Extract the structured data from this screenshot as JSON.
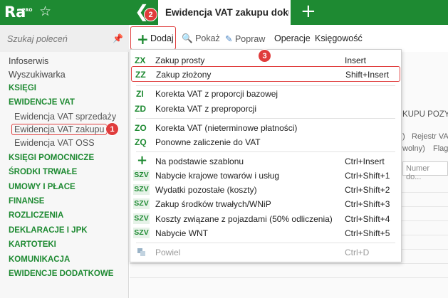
{
  "app": {
    "logo_text": "Ra",
    "logo_badge": "PRO",
    "active_tab": "Ewidencja VAT zakupu dokumenty"
  },
  "sidebar": {
    "search_placeholder": "Szukaj poleceń",
    "items": [
      {
        "label": "Infoserwis"
      },
      {
        "label": "Wyszukiwarka"
      },
      {
        "label": "KSIĘGI"
      },
      {
        "label": "EWIDENCJE VAT"
      },
      {
        "label": "Ewidencja VAT sprzedaży"
      },
      {
        "label": "Ewidencja VAT zakupu"
      },
      {
        "label": "Ewidencja VAT OSS"
      },
      {
        "label": "KSIĘGI POMOCNICZE"
      },
      {
        "label": "ŚRODKI TRWAŁE"
      },
      {
        "label": "UMOWY I PŁACE"
      },
      {
        "label": "FINANSE"
      },
      {
        "label": "ROZLICZENIA"
      },
      {
        "label": "DEKLARACJE I JPK"
      },
      {
        "label": "KARTOTEKI"
      },
      {
        "label": "KOMUNIKACJA"
      },
      {
        "label": "EWIDENCJE DODATKOWE"
      }
    ]
  },
  "toolbar": {
    "add_label": "Dodaj",
    "show_label": "Pokaż",
    "edit_label": "Popraw",
    "operations_label": "Operacje",
    "accounting_label": "Księgowość"
  },
  "background": {
    "title_fragment": "KUPU POZY",
    "rejestr": "Rejestr VA",
    "dowolny": "wolny)",
    "flag": "Flag",
    "paren": ")",
    "number_placeholder": "Numer do..."
  },
  "badges": {
    "one": "1",
    "two": "2",
    "three": "3"
  },
  "menu": {
    "items": [
      {
        "code": "ZX",
        "label": "Zakup prosty",
        "shortcut": "Insert"
      },
      {
        "code": "ZZ",
        "label": "Zakup złożony",
        "shortcut": "Shift+Insert"
      },
      {
        "code": "ZI",
        "label": "Korekta VAT z proporcji bazowej",
        "shortcut": ""
      },
      {
        "code": "ZD",
        "label": "Korekta VAT z preproporcji",
        "shortcut": ""
      },
      {
        "code": "ZO",
        "label": "Korekta VAT (nieterminowe płatności)",
        "shortcut": ""
      },
      {
        "code": "ZQ",
        "label": "Ponowne zaliczenie do VAT",
        "shortcut": ""
      },
      {
        "code": "",
        "label": "Na podstawie szablonu",
        "shortcut": "Ctrl+Insert"
      },
      {
        "code": "SZV",
        "label": "Nabycie krajowe towarów i usług",
        "shortcut": "Ctrl+Shift+1"
      },
      {
        "code": "SZV",
        "label": "Wydatki pozostałe (koszty)",
        "shortcut": "Ctrl+Shift+2"
      },
      {
        "code": "SZV",
        "label": "Zakup środków trwałych/WNiP",
        "shortcut": "Ctrl+Shift+3"
      },
      {
        "code": "SZV",
        "label": "Koszty związane z pojazdami (50% odliczenia)",
        "shortcut": "Ctrl+Shift+4"
      },
      {
        "code": "SZV",
        "label": "Nabycie WNT",
        "shortcut": "Ctrl+Shift+5"
      },
      {
        "code": "",
        "label": "Powiel",
        "shortcut": "Ctrl+D"
      }
    ]
  }
}
